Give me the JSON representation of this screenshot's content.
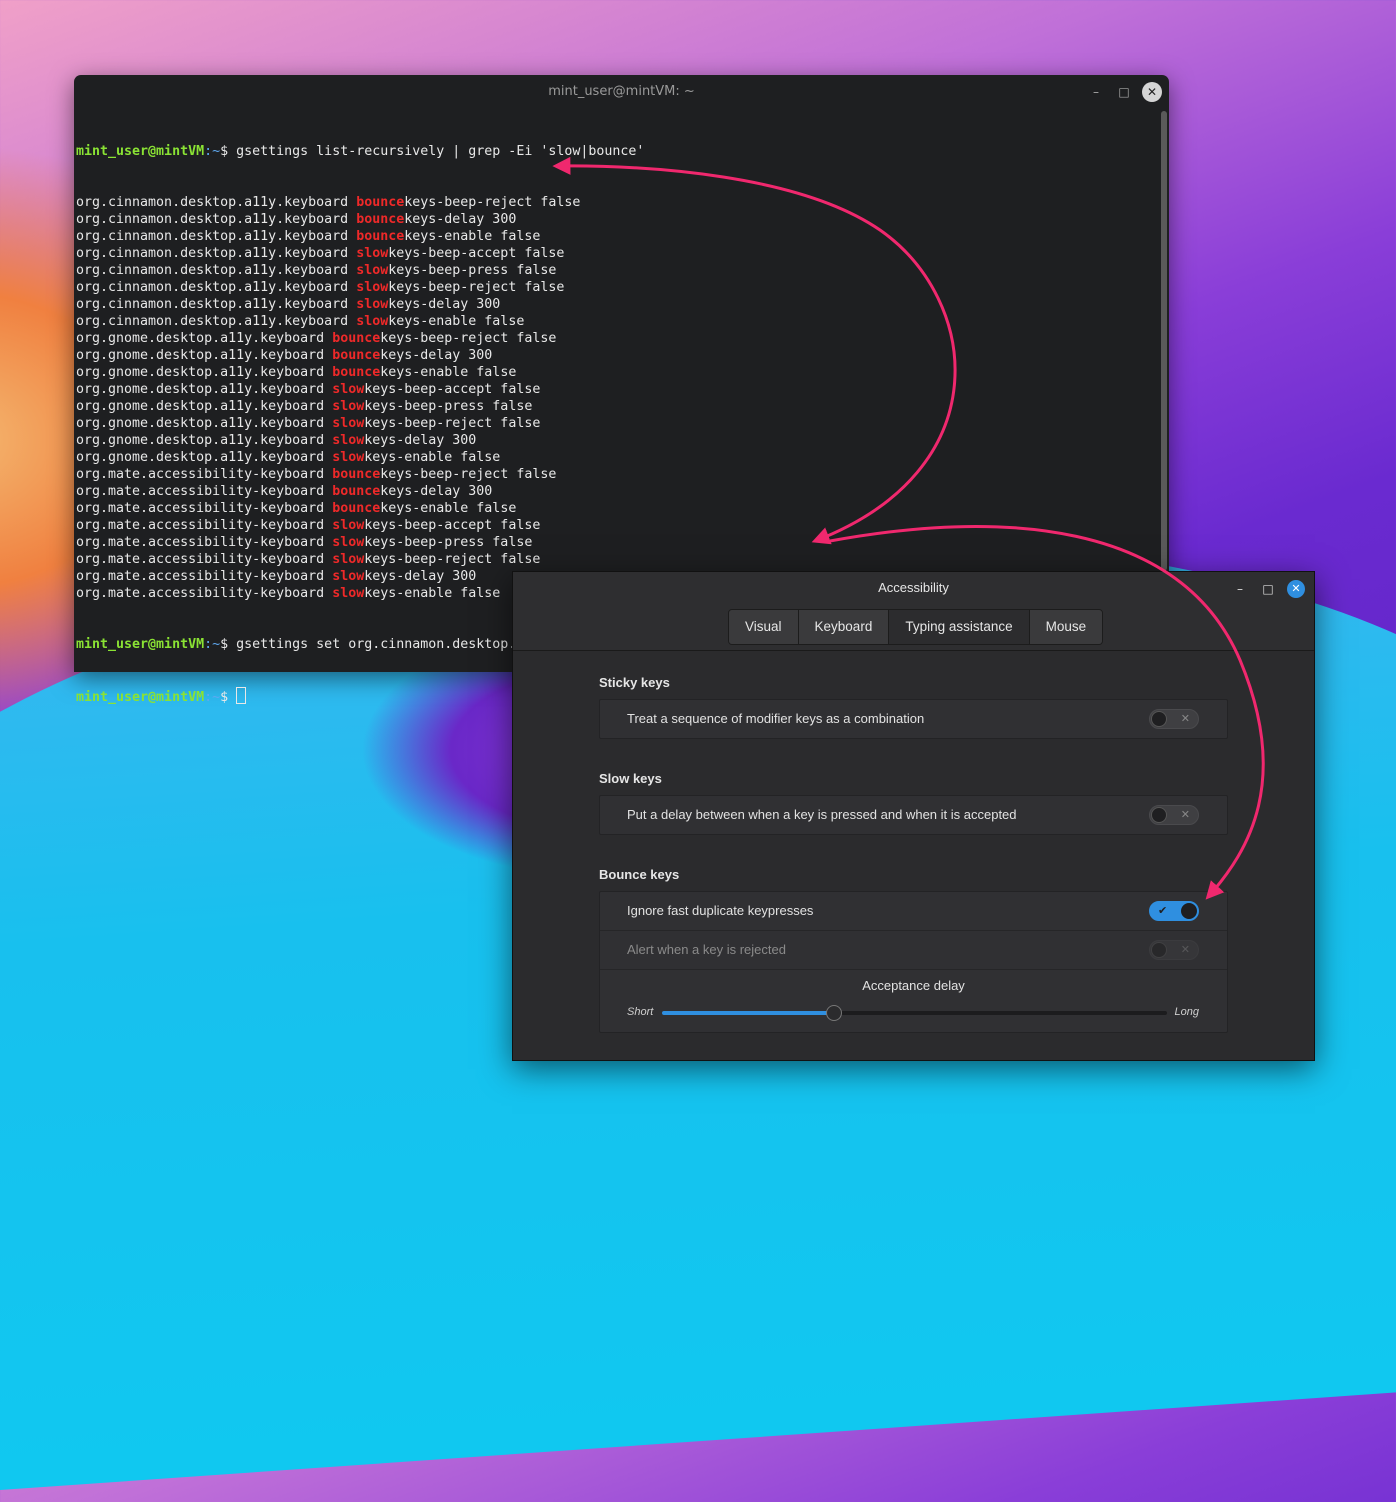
{
  "terminal": {
    "title": "mint_user@mintVM: ~",
    "prompt_user": "mint_user@mintVM",
    "prompt_path": ":~",
    "prompt_symbol": "$ ",
    "command1": "gsettings list-recursively | grep -Ei 'slow|bounce'",
    "output": [
      {
        "prefix": "org.cinnamon.desktop.a11y.keyboard ",
        "match": "bounce",
        "suffix": "keys-beep-reject false"
      },
      {
        "prefix": "org.cinnamon.desktop.a11y.keyboard ",
        "match": "bounce",
        "suffix": "keys-delay 300"
      },
      {
        "prefix": "org.cinnamon.desktop.a11y.keyboard ",
        "match": "bounce",
        "suffix": "keys-enable false"
      },
      {
        "prefix": "org.cinnamon.desktop.a11y.keyboard ",
        "match": "slow",
        "suffix": "keys-beep-accept false"
      },
      {
        "prefix": "org.cinnamon.desktop.a11y.keyboard ",
        "match": "slow",
        "suffix": "keys-beep-press false"
      },
      {
        "prefix": "org.cinnamon.desktop.a11y.keyboard ",
        "match": "slow",
        "suffix": "keys-beep-reject false"
      },
      {
        "prefix": "org.cinnamon.desktop.a11y.keyboard ",
        "match": "slow",
        "suffix": "keys-delay 300"
      },
      {
        "prefix": "org.cinnamon.desktop.a11y.keyboard ",
        "match": "slow",
        "suffix": "keys-enable false"
      },
      {
        "prefix": "org.gnome.desktop.a11y.keyboard ",
        "match": "bounce",
        "suffix": "keys-beep-reject false"
      },
      {
        "prefix": "org.gnome.desktop.a11y.keyboard ",
        "match": "bounce",
        "suffix": "keys-delay 300"
      },
      {
        "prefix": "org.gnome.desktop.a11y.keyboard ",
        "match": "bounce",
        "suffix": "keys-enable false"
      },
      {
        "prefix": "org.gnome.desktop.a11y.keyboard ",
        "match": "slow",
        "suffix": "keys-beep-accept false"
      },
      {
        "prefix": "org.gnome.desktop.a11y.keyboard ",
        "match": "slow",
        "suffix": "keys-beep-press false"
      },
      {
        "prefix": "org.gnome.desktop.a11y.keyboard ",
        "match": "slow",
        "suffix": "keys-beep-reject false"
      },
      {
        "prefix": "org.gnome.desktop.a11y.keyboard ",
        "match": "slow",
        "suffix": "keys-delay 300"
      },
      {
        "prefix": "org.gnome.desktop.a11y.keyboard ",
        "match": "slow",
        "suffix": "keys-enable false"
      },
      {
        "prefix": "org.mate.accessibility-keyboard ",
        "match": "bounce",
        "suffix": "keys-beep-reject false"
      },
      {
        "prefix": "org.mate.accessibility-keyboard ",
        "match": "bounce",
        "suffix": "keys-delay 300"
      },
      {
        "prefix": "org.mate.accessibility-keyboard ",
        "match": "bounce",
        "suffix": "keys-enable false"
      },
      {
        "prefix": "org.mate.accessibility-keyboard ",
        "match": "slow",
        "suffix": "keys-beep-accept false"
      },
      {
        "prefix": "org.mate.accessibility-keyboard ",
        "match": "slow",
        "suffix": "keys-beep-press false"
      },
      {
        "prefix": "org.mate.accessibility-keyboard ",
        "match": "slow",
        "suffix": "keys-beep-reject false"
      },
      {
        "prefix": "org.mate.accessibility-keyboard ",
        "match": "slow",
        "suffix": "keys-delay 300"
      },
      {
        "prefix": "org.mate.accessibility-keyboard ",
        "match": "slow",
        "suffix": "keys-enable false"
      }
    ],
    "command2": "gsettings set org.cinnamon.desktop.a11y.keyboard bouncekeys-enable true"
  },
  "a11y": {
    "title": "Accessibility",
    "tabs": [
      {
        "label": "Visual",
        "active": false
      },
      {
        "label": "Keyboard",
        "active": false
      },
      {
        "label": "Typing assistance",
        "active": true
      },
      {
        "label": "Mouse",
        "active": false
      }
    ],
    "sticky": {
      "title": "Sticky keys",
      "row": "Treat a sequence of modifier keys as a combination",
      "on": false
    },
    "slow": {
      "title": "Slow keys",
      "row": "Put a delay between when a key is pressed and when it is accepted",
      "on": false
    },
    "bounce": {
      "title": "Bounce keys",
      "row1": "Ignore fast duplicate keypresses",
      "row1_on": true,
      "row2": "Alert when a key is rejected",
      "row2_on": false,
      "slider_title": "Acceptance delay",
      "slider_min": "Short",
      "slider_max": "Long",
      "slider_value": 0.34
    }
  },
  "colors": {
    "accent": "#2f8fe0",
    "arrow": "#f0286e",
    "match": "#ef2929",
    "prompt_user": "#8ae234"
  }
}
